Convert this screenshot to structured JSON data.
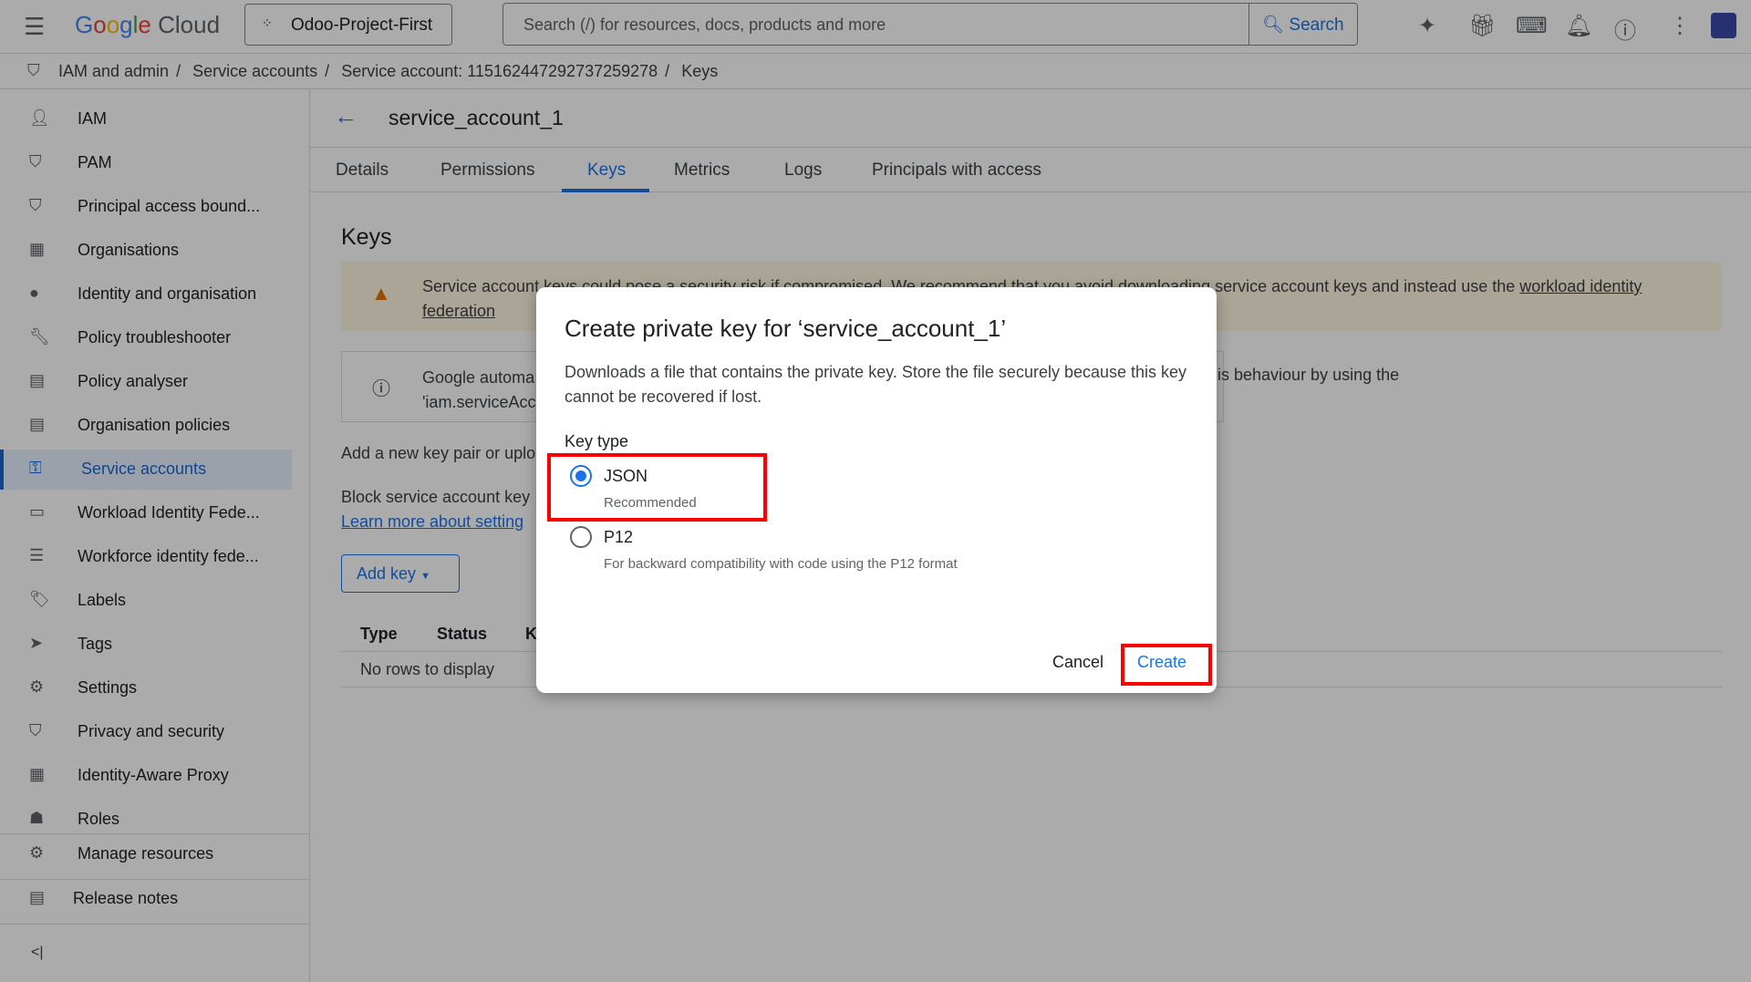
{
  "topbar": {
    "brand": "Google Cloud",
    "project": "Odoo-Project-First",
    "search_placeholder": "Search (/) for resources, docs, products and more",
    "search_button": "Search"
  },
  "breadcrumb": [
    "IAM and admin",
    "Service accounts",
    "Service account: 115162447292737259278",
    "Keys"
  ],
  "sidebar": {
    "items": [
      "IAM",
      "PAM",
      "Principal access bound...",
      "Organisations",
      "Identity and organisation",
      "Policy troubleshooter",
      "Policy analyser",
      "Organisation policies",
      "Service accounts",
      "Workload Identity Fede...",
      "Workforce identity fede...",
      "Labels",
      "Tags",
      "Settings",
      "Privacy and security",
      "Identity-Aware Proxy",
      "Roles"
    ],
    "manage": "Manage resources",
    "release": "Release notes",
    "collapse": "<|"
  },
  "page": {
    "title": "service_account_1",
    "tabs": [
      "Details",
      "Permissions",
      "Keys",
      "Metrics",
      "Logs",
      "Principals with access"
    ],
    "section": "Keys",
    "warning": "Service account keys could pose a security risk if compromised. We recommend that you avoid downloading service account keys and instead use the",
    "warning_link": "workload identity federation",
    "info_start": "Google automa",
    "info_start2": "'iam.serviceAcc",
    "info_end": "is behaviour by using the",
    "add_text": "Add a new key pair or uplo",
    "block_text": "Block service account key",
    "learn_more": "Learn more about setting",
    "add_key": "Add key",
    "table_headers": [
      "Type",
      "Status",
      "K"
    ],
    "empty": "No rows to display"
  },
  "dialog": {
    "title": "Create private key for ‘service_account_1’",
    "description": "Downloads a file that contains the private key. Store the file securely because this key cannot be recovered if lost.",
    "key_type_label": "Key type",
    "options": [
      {
        "label": "JSON",
        "hint": "Recommended",
        "selected": true
      },
      {
        "label": "P12",
        "hint": "For backward compatibility with code using the P12 format",
        "selected": false
      }
    ],
    "cancel": "Cancel",
    "create": "Create"
  }
}
